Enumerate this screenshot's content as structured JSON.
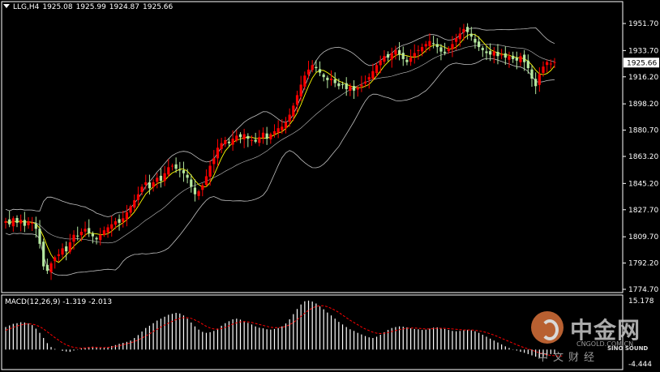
{
  "header": {
    "symbol": "LLG,H4",
    "open": "1925.08",
    "high": "1925.99",
    "low": "1924.87",
    "close": "1925.66"
  },
  "macd_header": {
    "label": "MACD(12,26,9)",
    "main": "-1.319",
    "signal": "-2.013"
  },
  "watermark": {
    "brand": "中金网",
    "domain": "CNGOLD.COM.CN",
    "sub": "中文财经",
    "sound": "SINO SOUND"
  },
  "colors": {
    "background": "#000000",
    "up_candle": "#ff0000",
    "down_candle": "#b5e8a0",
    "bollinger": "#c0c0c0",
    "ma": "#ffff00",
    "macd_hist": "#ffffff",
    "macd_signal": "#ff0000",
    "current_price_box": "#ffffff"
  },
  "chart_data": [
    {
      "type": "candlestick",
      "title": "LLG,H4",
      "price_axis_ticks": [
        "1951.70",
        "1933.70",
        "1916.20",
        "1898.20",
        "1880.70",
        "1863.20",
        "1845.20",
        "1827.70",
        "1809.70",
        "1792.20",
        "1774.70"
      ],
      "current_price": "1925.66",
      "ylim": [
        1774.7,
        1955.0
      ],
      "indicators": [
        "bollinger-bands",
        "moving-average"
      ],
      "grid": false,
      "close_series": [
        1820,
        1818,
        1822,
        1819,
        1821,
        1817,
        1820,
        1819,
        1815,
        1805,
        1790,
        1787,
        1792,
        1796,
        1798,
        1802,
        1800,
        1806,
        1811,
        1810,
        1813,
        1815,
        1812,
        1810,
        1808,
        1811,
        1814,
        1816,
        1818,
        1820,
        1819,
        1822,
        1826,
        1830,
        1834,
        1838,
        1843,
        1846,
        1842,
        1846,
        1849,
        1847,
        1852,
        1856,
        1857,
        1855,
        1854,
        1852,
        1849,
        1843,
        1838,
        1840,
        1844,
        1850,
        1857,
        1862,
        1869,
        1872,
        1874,
        1872,
        1875,
        1877,
        1876,
        1878,
        1875,
        1874,
        1873,
        1876,
        1879,
        1875,
        1878,
        1880,
        1882,
        1883,
        1886,
        1891,
        1897,
        1904,
        1911,
        1917,
        1921,
        1924,
        1922,
        1919,
        1916,
        1914,
        1915,
        1912,
        1910,
        1911,
        1908,
        1910,
        1907,
        1909,
        1911,
        1913,
        1916,
        1920,
        1924,
        1927,
        1930,
        1929,
        1932,
        1934,
        1931,
        1928,
        1926,
        1929,
        1932,
        1934,
        1936,
        1938,
        1940,
        1938,
        1936,
        1933,
        1932,
        1935,
        1938,
        1942,
        1945,
        1948,
        1946,
        1943,
        1939,
        1936,
        1934,
        1932,
        1931,
        1933,
        1930,
        1931,
        1929,
        1930,
        1928,
        1927,
        1930,
        1926,
        1922,
        1915,
        1910,
        1918,
        1923,
        1926,
        1925,
        1926
      ]
    },
    {
      "type": "bar",
      "title": "MACD(12,26,9)",
      "price_axis_ticks": [
        "15.178",
        "-4.444"
      ],
      "ylim": [
        -4.444,
        15.178
      ],
      "series": [
        {
          "name": "MACD",
          "values": [
            7,
            7.5,
            8,
            8.2,
            8.5,
            8.4,
            8.1,
            7.6,
            6.5,
            5.2,
            3.6,
            2,
            0.8,
            0.2,
            0,
            -0.4,
            -0.6,
            -0.7,
            -0.3,
            0.1,
            0.4,
            0.6,
            0.8,
            0.9,
            0.7,
            0.5,
            0.6,
            0.8,
            1.1,
            1.4,
            1.8,
            2.1,
            2.4,
            2.8,
            3.6,
            4.5,
            5.6,
            6.7,
            7.4,
            8.2,
            9,
            9.6,
            10.2,
            10.8,
            11.1,
            11.4,
            11.2,
            10.6,
            9.6,
            8.4,
            7.2,
            6.2,
            5.5,
            5.2,
            5.4,
            5.8,
            6.5,
            7.4,
            8.2,
            8.8,
            9.4,
            9.6,
            9.3,
            8.8,
            8.3,
            7.8,
            7.2,
            6.8,
            6.6,
            6.3,
            6.2,
            6.4,
            6.7,
            7.2,
            8.1,
            9.4,
            11,
            12.6,
            14,
            15,
            15.2,
            14.9,
            14.3,
            13.4,
            12.5,
            11.5,
            10.6,
            9.6,
            8.6,
            7.8,
            7,
            6.3,
            5.8,
            5.2,
            4.7,
            4.2,
            3.8,
            3.6,
            4,
            4.6,
            5.4,
            6.1,
            6.7,
            7,
            7.2,
            7.1,
            6.9,
            6.6,
            6.4,
            6.3,
            6.1,
            6.2,
            6.5,
            6.8,
            6.9,
            6.7,
            6.4,
            6.1,
            5.8,
            5.7,
            5.8,
            6,
            6.1,
            6,
            5.7,
            5.2,
            4.6,
            4,
            3.4,
            2.8,
            2.2,
            1.6,
            1,
            0.5,
            0.1,
            -0.3,
            -0.7,
            -1,
            -1.4,
            -1.8,
            -2.2,
            -2.4,
            -2.3,
            -1.8,
            -1.4,
            -1.3
          ]
        },
        {
          "name": "Signal",
          "values": [
            6,
            6.4,
            6.9,
            7.3,
            7.6,
            7.9,
            8,
            7.9,
            7.6,
            7.1,
            6.4,
            5.5,
            4.6,
            3.7,
            2.9,
            2.1,
            1.5,
            1,
            0.7,
            0.5,
            0.4,
            0.5,
            0.6,
            0.7,
            0.7,
            0.6,
            0.6,
            0.7,
            0.8,
            1,
            1.2,
            1.5,
            1.8,
            2.1,
            2.5,
            3,
            3.6,
            4.2,
            4.9,
            5.6,
            6.3,
            7,
            7.6,
            8.2,
            8.8,
            9.3,
            9.7,
            9.9,
            9.9,
            9.7,
            9.2,
            8.6,
            7.9,
            7.2,
            6.7,
            6.4,
            6.3,
            6.5,
            6.9,
            7.4,
            7.9,
            8.3,
            8.6,
            8.7,
            8.6,
            8.4,
            8.1,
            7.8,
            7.5,
            7.2,
            6.9,
            6.8,
            6.8,
            6.9,
            7.2,
            7.7,
            8.4,
            9.3,
            10.3,
            11.3,
            12.2,
            12.9,
            13.4,
            13.6,
            13.6,
            13.3,
            12.8,
            12.2,
            11.5,
            10.7,
            9.9,
            9.1,
            8.4,
            7.7,
            7,
            6.4,
            5.9,
            5.4,
            5.1,
            5,
            5.1,
            5.3,
            5.6,
            5.9,
            6.2,
            6.4,
            6.6,
            6.7,
            6.7,
            6.6,
            6.5,
            6.4,
            6.4,
            6.5,
            6.6,
            6.6,
            6.6,
            6.5,
            6.4,
            6.3,
            6.2,
            6.1,
            6.1,
            6.1,
            6,
            5.8,
            5.6,
            5.3,
            4.9,
            4.5,
            4,
            3.5,
            3,
            2.5,
            2,
            1.5,
            1,
            0.6,
            0.2,
            -0.2,
            -0.6,
            -1,
            -1.3,
            -1.6,
            -1.8,
            -1.9,
            -2,
            -2
          ]
        }
      ]
    }
  ]
}
